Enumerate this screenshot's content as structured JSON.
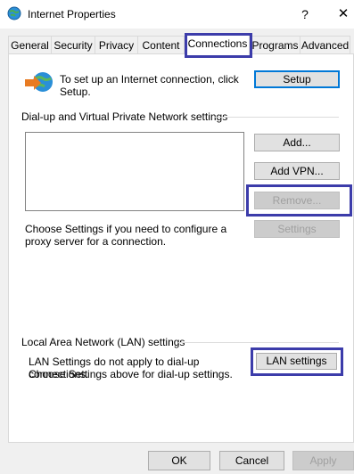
{
  "window": {
    "title": "Internet Properties",
    "help_glyph": "?",
    "close_glyph": "✕"
  },
  "tabs": [
    {
      "label": "General"
    },
    {
      "label": "Security"
    },
    {
      "label": "Privacy"
    },
    {
      "label": "Content"
    },
    {
      "label": "Connections",
      "active": true
    },
    {
      "label": "Programs"
    },
    {
      "label": "Advanced"
    }
  ],
  "setup": {
    "text": "To set up an Internet connection, click Setup.",
    "button": "Setup"
  },
  "vpn": {
    "heading": "Dial-up and Virtual Private Network settings",
    "add_button": "Add...",
    "add_vpn_button": "Add VPN...",
    "remove_button": "Remove...",
    "proxy_text": "Choose Settings if you need to configure a proxy server for a connection.",
    "settings_button": "Settings"
  },
  "lan": {
    "heading": "Local Area Network (LAN) settings",
    "text_line1": "LAN Settings do not apply to dial-up connections.",
    "text_line2": "Choose Settings above for dial-up settings.",
    "button": "LAN settings"
  },
  "footer": {
    "ok": "OK",
    "cancel": "Cancel",
    "apply": "Apply"
  },
  "colors": {
    "highlight_outline": "#3c3caa",
    "default_button_border": "#0078d7"
  }
}
